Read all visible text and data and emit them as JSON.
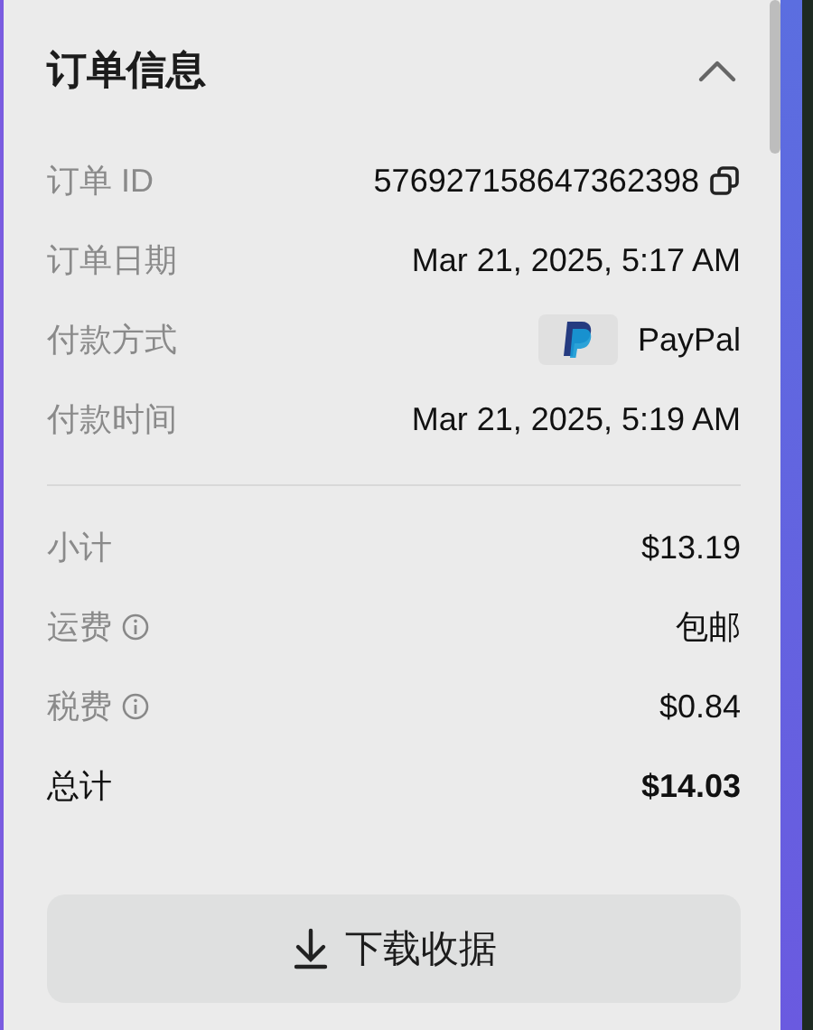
{
  "panel": {
    "title": "订单信息",
    "expanded": true
  },
  "details": [
    {
      "label": "订单 ID",
      "value": "576927158647362398",
      "kind": "copy"
    },
    {
      "label": "订单日期",
      "value": "Mar 21, 2025, 5:17 AM",
      "kind": "text"
    },
    {
      "label": "付款方式",
      "value": "PayPal",
      "kind": "payment"
    },
    {
      "label": "付款时间",
      "value": "Mar 21, 2025, 5:19 AM",
      "kind": "text"
    }
  ],
  "summary": [
    {
      "label": "小计",
      "value": "$13.19",
      "info": false,
      "kind": "line"
    },
    {
      "label": "运费",
      "value": "包邮",
      "info": true,
      "kind": "line"
    },
    {
      "label": "税费",
      "value": "$0.84",
      "info": true,
      "kind": "line"
    },
    {
      "label": "总计",
      "value": "$14.03",
      "info": false,
      "kind": "total"
    }
  ],
  "button": {
    "label": "下载收据"
  }
}
